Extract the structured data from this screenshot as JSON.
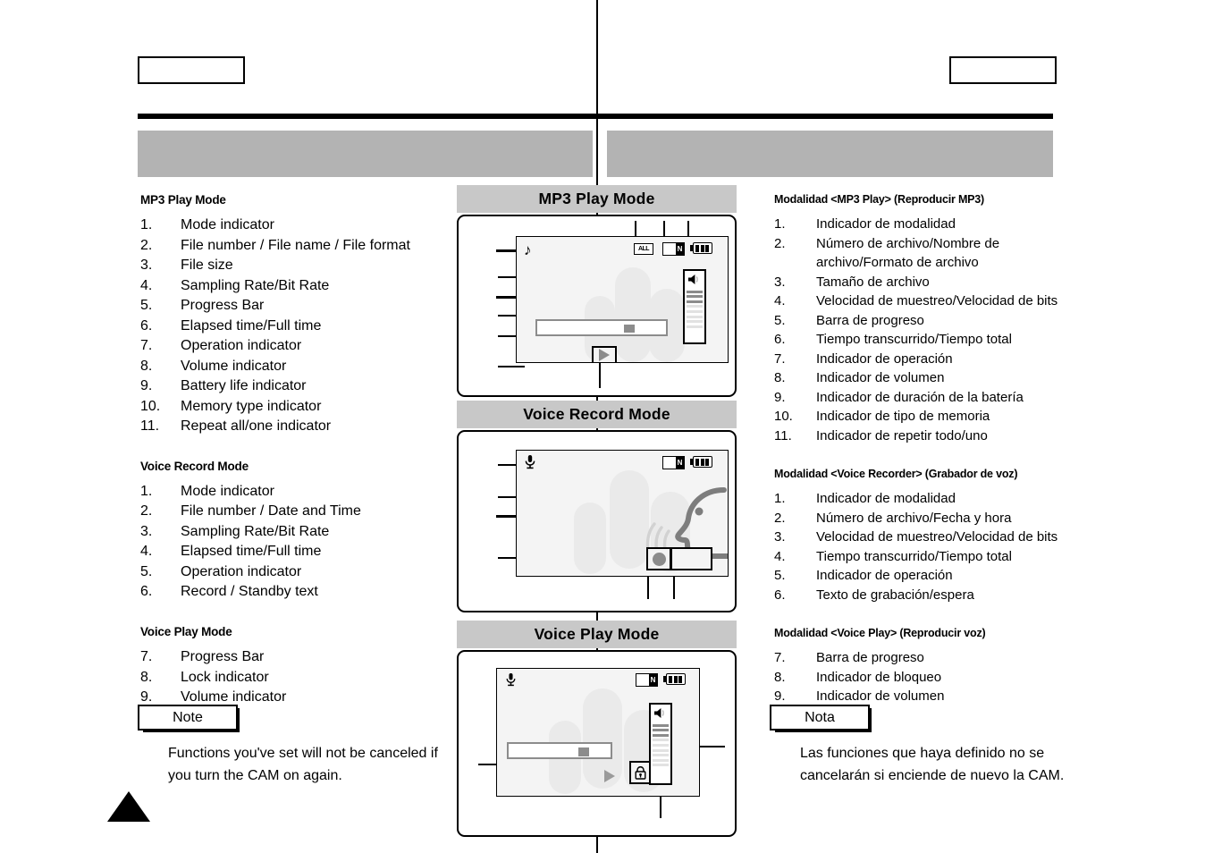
{
  "page": {
    "center_divider": true,
    "corner_marker": "triangle-marker"
  },
  "english": {
    "sections": [
      {
        "title": "MP3 Play Mode",
        "items": [
          {
            "n": "1.",
            "text": "Mode indicator"
          },
          {
            "n": "2.",
            "text": "File number / File name / File format"
          },
          {
            "n": "3.",
            "text": "File size"
          },
          {
            "n": "4.",
            "text": "Sampling Rate/Bit Rate"
          },
          {
            "n": "5.",
            "text": "Progress Bar"
          },
          {
            "n": "6.",
            "text": "Elapsed time/Full time"
          },
          {
            "n": "7.",
            "text": "Operation indicator"
          },
          {
            "n": "8.",
            "text": "Volume indicator"
          },
          {
            "n": "9.",
            "text": "Battery life indicator"
          },
          {
            "n": "10.",
            "text": "Memory type indicator"
          },
          {
            "n": "11.",
            "text": "Repeat all/one indicator"
          }
        ]
      },
      {
        "title": "Voice Record Mode",
        "items": [
          {
            "n": "1.",
            "text": "Mode indicator"
          },
          {
            "n": "2.",
            "text": "File number / Date and Time"
          },
          {
            "n": "3.",
            "text": "Sampling Rate/Bit Rate"
          },
          {
            "n": "4.",
            "text": "Elapsed time/Full time"
          },
          {
            "n": "5.",
            "text": "Operation indicator"
          },
          {
            "n": "6.",
            "text": "Record / Standby text"
          }
        ]
      },
      {
        "title": "Voice Play Mode",
        "items": [
          {
            "n": "7.",
            "text": "Progress Bar"
          },
          {
            "n": "8.",
            "text": "Lock indicator"
          },
          {
            "n": "9.",
            "text": "Volume indicator"
          }
        ]
      }
    ],
    "note": {
      "label": "Note",
      "body": "Functions you've set will not be canceled if you turn the CAM on again."
    }
  },
  "spanish": {
    "sections": [
      {
        "title": "Modalidad <MP3 Play> (Reproducir MP3)",
        "items": [
          {
            "n": "1.",
            "text": "Indicador de modalidad"
          },
          {
            "n": "2.",
            "text": "Número de archivo/Nombre de archivo/Formato de archivo"
          },
          {
            "n": "3.",
            "text": "Tamaño de archivo"
          },
          {
            "n": "4.",
            "text": "Velocidad de muestreo/Velocidad de bits"
          },
          {
            "n": "5.",
            "text": "Barra de progreso"
          },
          {
            "n": "6.",
            "text": "Tiempo transcurrido/Tiempo total"
          },
          {
            "n": "7.",
            "text": "Indicador de operación"
          },
          {
            "n": "8.",
            "text": "Indicador de volumen"
          },
          {
            "n": "9.",
            "text": "Indicador de duración de la batería"
          },
          {
            "n": "10.",
            "text": "Indicador de tipo de memoria"
          },
          {
            "n": "11.",
            "text": "Indicador de repetir todo/uno"
          }
        ]
      },
      {
        "title": "Modalidad <Voice Recorder> (Grabador de voz)",
        "items": [
          {
            "n": "1.",
            "text": "Indicador de modalidad"
          },
          {
            "n": "2.",
            "text": "Número de archivo/Fecha y hora"
          },
          {
            "n": "3.",
            "text": "Velocidad de muestreo/Velocidad de bits"
          },
          {
            "n": "4.",
            "text": "Tiempo transcurrido/Tiempo total"
          },
          {
            "n": "5.",
            "text": "Indicador de operación"
          },
          {
            "n": "6.",
            "text": "Texto de grabación/espera"
          }
        ]
      },
      {
        "title": "Modalidad <Voice Play> (Reproducir voz)",
        "items": [
          {
            "n": "7.",
            "text": "Barra de progreso"
          },
          {
            "n": "8.",
            "text": "Indicador de bloqueo"
          },
          {
            "n": "9.",
            "text": "Indicador de volumen"
          }
        ]
      }
    ],
    "note": {
      "label": "Nota",
      "body": "Las funciones que haya definido no se cancelarán si enciende de nuevo la CAM."
    }
  },
  "panels": {
    "mp3": {
      "title": "MP3 Play Mode",
      "icons": {
        "mode": "music-note-icon",
        "repeat_badge": "ALL",
        "memory_badge": "N",
        "battery": "battery-icon",
        "operation": "play-icon"
      }
    },
    "voice_record": {
      "title": "Voice Record Mode",
      "icons": {
        "mode": "microphone-icon",
        "memory_badge": "N",
        "battery": "battery-icon",
        "operation": "record-dot-icon",
        "standby_text": ""
      }
    },
    "voice_play": {
      "title": "Voice Play Mode",
      "icons": {
        "mode": "microphone-icon",
        "memory_badge": "N",
        "battery": "battery-icon",
        "operation": "play-icon",
        "lock": "lock-icon"
      }
    }
  },
  "colors": {
    "gray_bar": "#b3b3b3",
    "panel_title_bg": "#c8c8c8",
    "lcd_bg": "#f4f4f4",
    "accent_gray": "#8c8c8c"
  }
}
